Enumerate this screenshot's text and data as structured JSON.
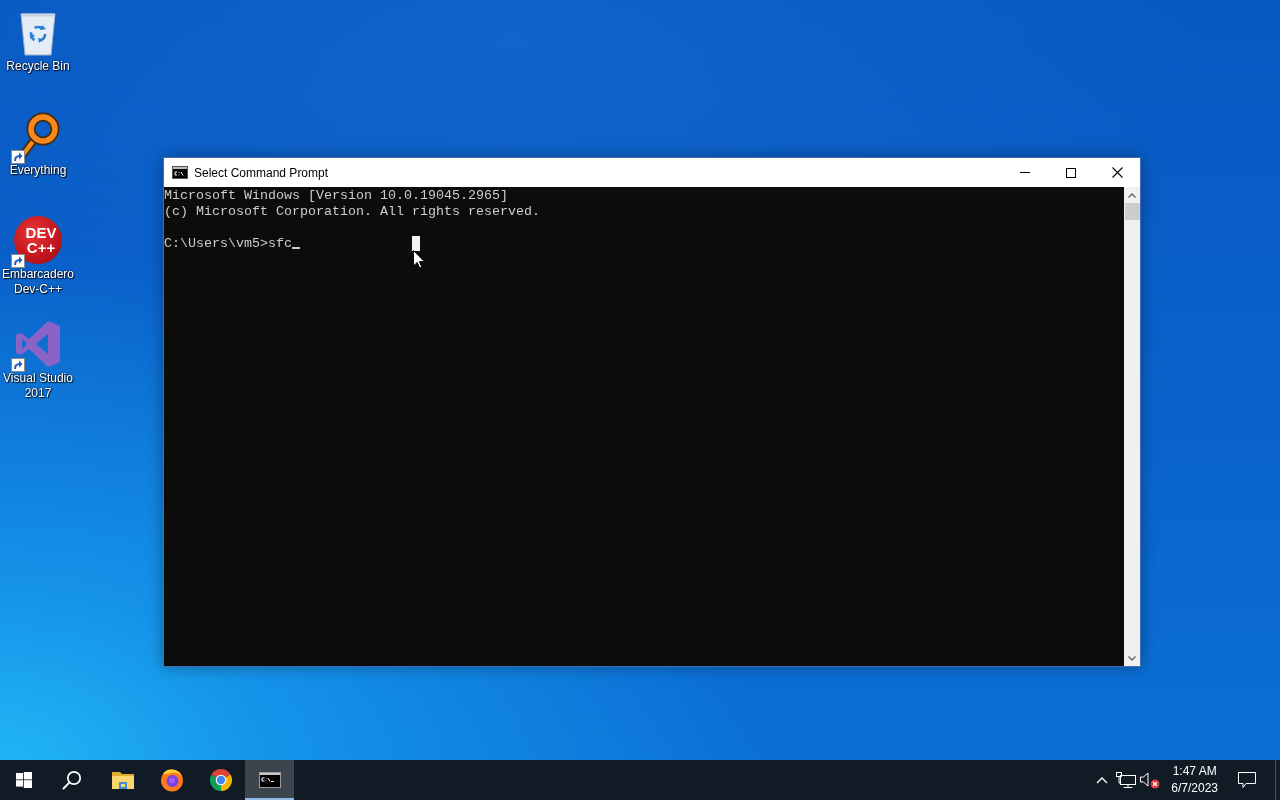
{
  "desktop_icons": [
    {
      "kind": "recycle",
      "label": "Recycle Bin",
      "shortcut": false
    },
    {
      "kind": "everything",
      "label": "Everything",
      "shortcut": true
    },
    {
      "kind": "devcpp",
      "label": "Embarcadero Dev-C++",
      "logo_lines": [
        "DEV",
        "C++"
      ],
      "shortcut": true
    },
    {
      "kind": "vstudio",
      "label": "Visual Studio 2017",
      "shortcut": true
    }
  ],
  "window": {
    "title": "Select Command Prompt",
    "console": {
      "output_lines": [
        "Microsoft Windows [Version 10.0.19045.2965]",
        "(c) Microsoft Corporation. All rights reserved."
      ],
      "prompt_line": "C:\\Users\\vm5>sfc",
      "text_cursor": true,
      "selection_cursor": true
    }
  },
  "taskbar": {
    "apps": [
      {
        "kind": "explorer",
        "active": false
      },
      {
        "kind": "firefox",
        "active": false
      },
      {
        "kind": "chrome",
        "active": false
      },
      {
        "kind": "terminal",
        "active": true
      }
    ],
    "tray": {
      "volume_muted": true
    },
    "clock": {
      "time": "1:47 AM",
      "date": "6/7/2023"
    }
  }
}
